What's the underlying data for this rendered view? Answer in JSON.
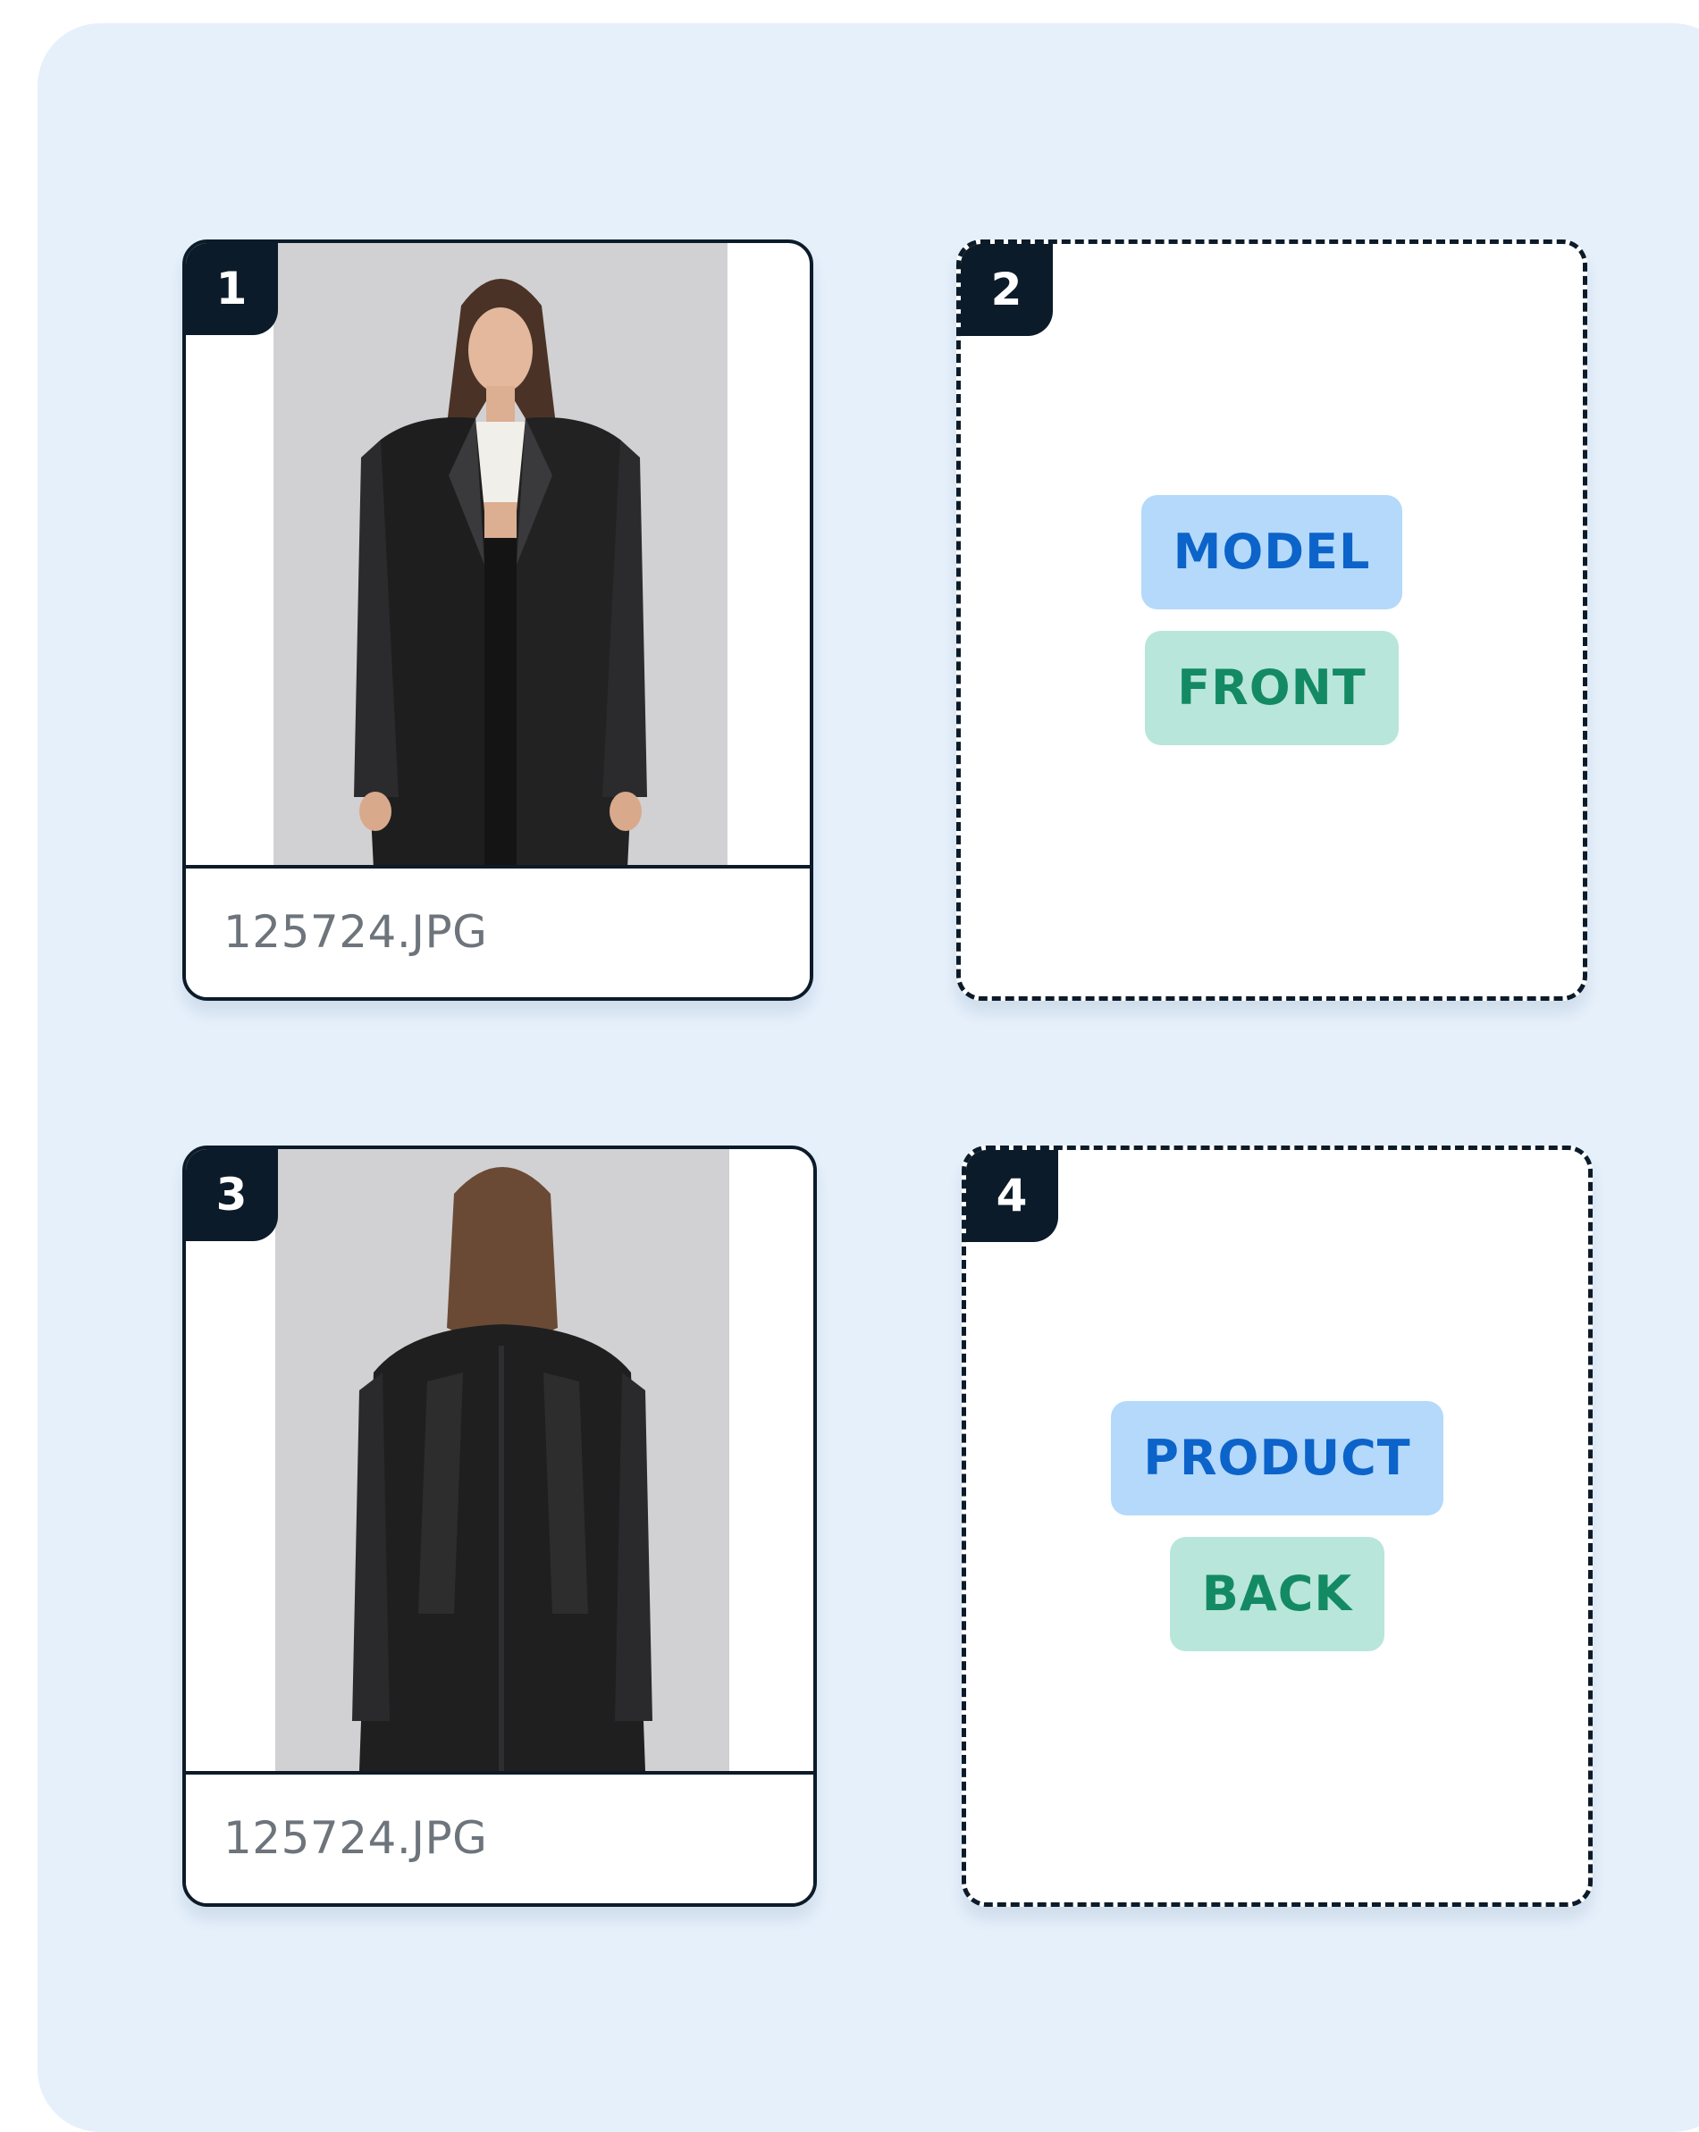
{
  "colors": {
    "panel_background": "#e5f0fb",
    "card_border": "#0c1b29",
    "badge_background": "#0c1b29",
    "tag_blue_background": "#b4d9fa",
    "tag_blue_text": "#0c63c9",
    "tag_green_background": "#b9e6da",
    "tag_green_text": "#138a63",
    "filename_text": "#6d747b"
  },
  "slots": [
    {
      "number": "1",
      "state": "filled",
      "photo": "model-front-leather-blazer",
      "filename": "125724.JPG"
    },
    {
      "number": "2",
      "state": "empty",
      "tags": [
        "MODEL",
        "FRONT"
      ]
    },
    {
      "number": "3",
      "state": "filled",
      "photo": "model-back-leather-blazer",
      "filename": "125724.JPG"
    },
    {
      "number": "4",
      "state": "empty",
      "tags": [
        "PRODUCT",
        "BACK"
      ]
    }
  ]
}
